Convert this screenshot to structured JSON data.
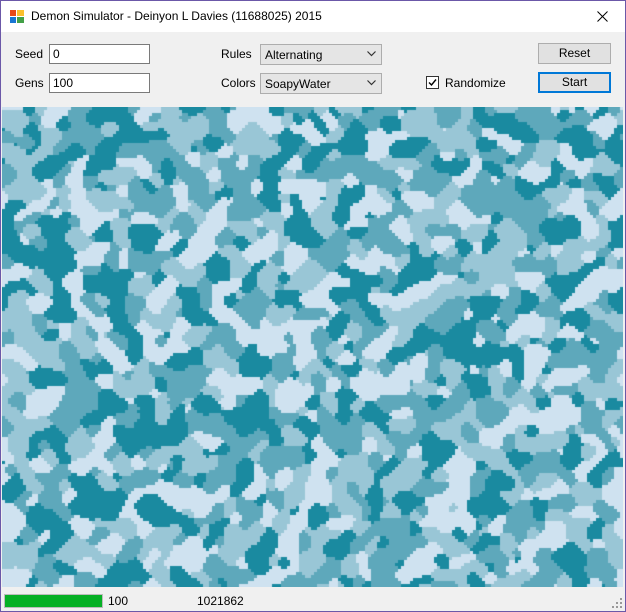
{
  "window": {
    "title": "Demon Simulator - Deinyon L Davies (11688025) 2015"
  },
  "controls": {
    "seed_label": "Seed",
    "seed_value": "0",
    "gens_label": "Gens",
    "gens_value": "100",
    "rules_label": "Rules",
    "rules_value": "Alternating",
    "colors_label": "Colors",
    "colors_value": "SoapyWater",
    "randomize_label": "Randomize",
    "randomize_checked": true,
    "reset_label": "Reset",
    "start_label": "Start"
  },
  "palette": [
    "#1a8aa0",
    "#5ea8bb",
    "#99c6d6",
    "#cfe2f0"
  ],
  "status": {
    "progress_fraction": 1.0,
    "progress_color": "#06b025",
    "generation": "100",
    "count": "1021862"
  },
  "icons": [
    "app-icon",
    "close-icon",
    "chevron-down-icon",
    "check-icon",
    "size-grip-icon"
  ]
}
